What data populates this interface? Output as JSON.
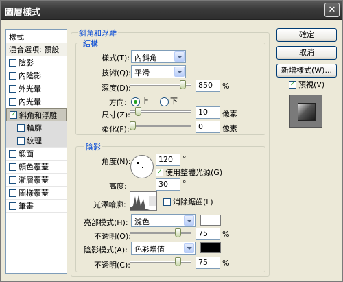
{
  "window": {
    "title": "圖層樣式"
  },
  "stylelist": {
    "header": "樣式",
    "blending": "混合選項: 預設",
    "items": [
      {
        "label": "陰影",
        "checked": false
      },
      {
        "label": "內陰影",
        "checked": false
      },
      {
        "label": "外光暈",
        "checked": false
      },
      {
        "label": "內光暈",
        "checked": false
      },
      {
        "label": "斜角和浮雕",
        "checked": true
      },
      {
        "label": "輪廓",
        "checked": false
      },
      {
        "label": "紋理",
        "checked": false
      },
      {
        "label": "緞面",
        "checked": false
      },
      {
        "label": "顏色覆蓋",
        "checked": false
      },
      {
        "label": "漸層覆蓋",
        "checked": false
      },
      {
        "label": "圖樣覆蓋",
        "checked": false
      },
      {
        "label": "筆畫",
        "checked": false
      }
    ]
  },
  "bevel": {
    "title": "斜角和浮雕",
    "structure": {
      "title": "結構",
      "style_label": "樣式(T):",
      "style_value": "內斜角",
      "technique_label": "技術(Q):",
      "technique_value": "平滑",
      "depth_label": "深度(D):",
      "depth_value": "850",
      "depth_unit": "%",
      "direction_label": "方向:",
      "direction_up": "上",
      "direction_down": "下",
      "size_label": "尺寸(Z):",
      "size_value": "10",
      "size_unit": "像素",
      "soften_label": "柔化(F):",
      "soften_value": "0",
      "soften_unit": "像素"
    },
    "shading": {
      "title": "陰影",
      "angle_label": "角度(N):",
      "angle_value": "120",
      "angle_unit": "°",
      "global_light_label": "使用整體光源(G)",
      "altitude_label": "高度:",
      "altitude_value": "30",
      "altitude_unit": "°",
      "gloss_label": "光澤輪廓:",
      "antialias_label": "消除鋸齒(L)",
      "highlight_mode_label": "亮部模式(H):",
      "highlight_mode_value": "濾色",
      "highlight_opacity_label": "不透明(O):",
      "highlight_opacity_value": "75",
      "highlight_opacity_unit": "%",
      "shadow_mode_label": "陰影模式(A):",
      "shadow_mode_value": "色彩增值",
      "shadow_opacity_label": "不透明(C):",
      "shadow_opacity_value": "75",
      "shadow_opacity_unit": "%"
    }
  },
  "buttons": {
    "ok": "確定",
    "cancel": "取消",
    "new_style": "新增樣式(W)...",
    "preview": "預視(V)"
  },
  "colors": {
    "accent": "#0046d5",
    "highlight_color": "#ffffff",
    "shadow_color": "#000000"
  }
}
